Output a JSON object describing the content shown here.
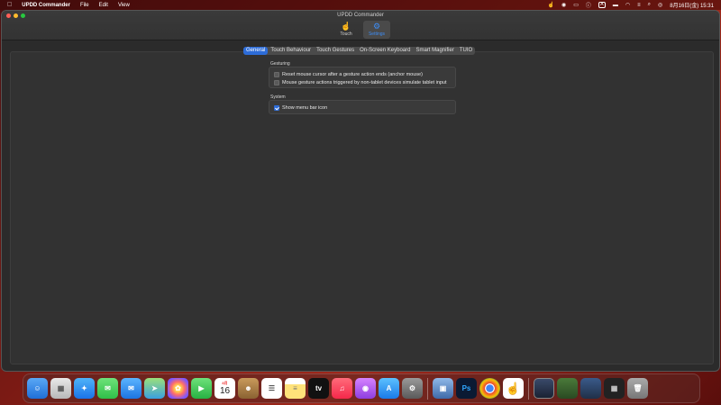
{
  "menubar": {
    "apple": "",
    "app_name": "UPDD Commander",
    "menus": [
      "File",
      "Edit",
      "View"
    ],
    "status_items": [
      "A",
      "8月16日(金) 15:31"
    ]
  },
  "window": {
    "title": "UPDD Commander",
    "toolbar": [
      {
        "label": "Touch",
        "icon": "hand-icon"
      },
      {
        "label": "Settings",
        "icon": "gear-icon",
        "active": true
      }
    ],
    "tabs": [
      "General",
      "Touch Behaviour",
      "Touch Gestures",
      "On-Screen Keyboard",
      "Smart Magnifier",
      "TUIO"
    ],
    "active_tab": "General"
  },
  "gesturing": {
    "label": "Gesturing",
    "options": [
      {
        "label": "Reset mouse cursor after a gesture action ends (anchor mouse)",
        "checked": false
      },
      {
        "label": "Mouse gesture actions triggered by non-tablet devices simulate tablet input",
        "checked": false
      }
    ]
  },
  "system": {
    "label": "System",
    "options": [
      {
        "label": "Show menu bar icon",
        "checked": true
      }
    ]
  },
  "dock": {
    "calendar_month": "8月",
    "calendar_day": "16",
    "tv_label": "tv",
    "ps_label": "Ps"
  },
  "colors": {
    "accent": "#2d6cd8",
    "window_bg": "#2b2b2b"
  }
}
